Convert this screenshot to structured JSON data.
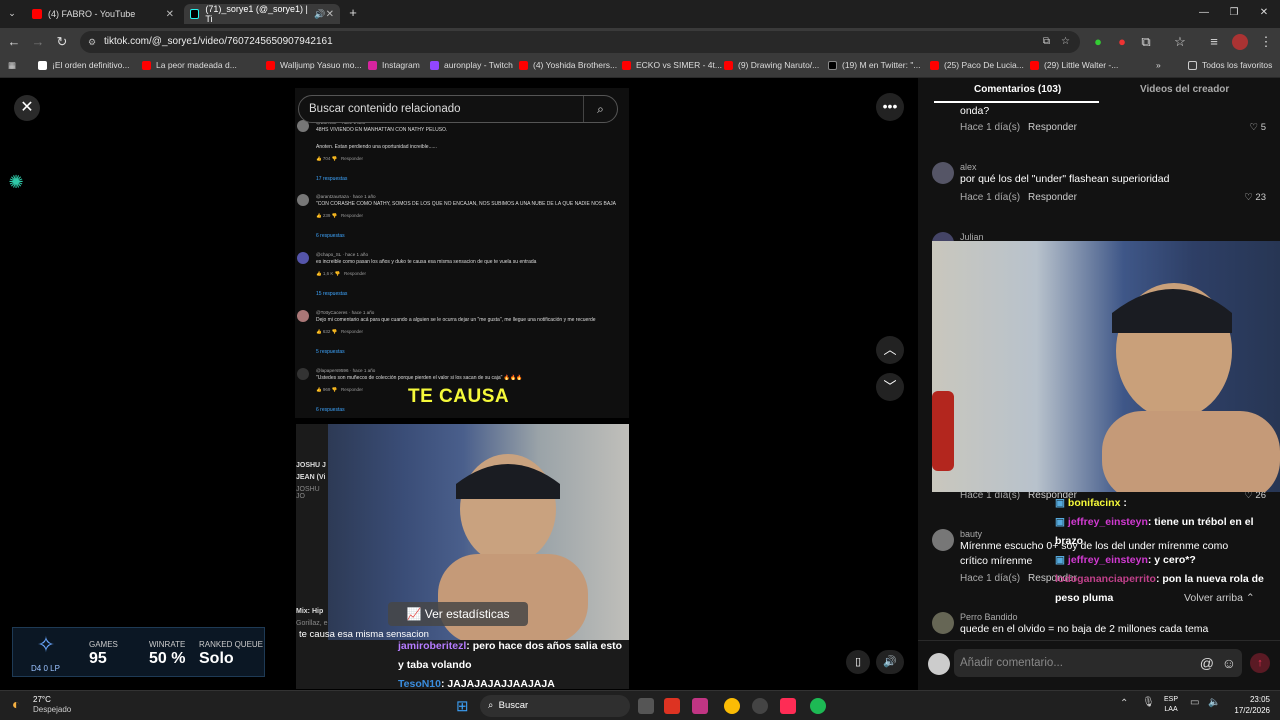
{
  "browser": {
    "tabs": [
      {
        "label": "(4) FABRO - YouTube",
        "active": false
      },
      {
        "label": "(71)_sorye1 (@_sorye1) | Ti",
        "active": true
      }
    ],
    "url": "tiktok.com/@_sorye1/video/7607245650907942161",
    "bookmarks": [
      "¡El orden definitivo...",
      "La peor madeada d...",
      "Walljump Yasuo mo...",
      "Instagram",
      "auronplay - Twitch",
      "(4) Yoshida Brothers...",
      "ECKO vs SIMER - 4t...",
      "(9) Drawing Naruto/...",
      "(19) M en Twitter: \"...",
      "(25) Paco De Lucia...",
      "(29) Little Walter -...",
      "Todos los favoritos"
    ]
  },
  "video": {
    "search_placeholder": "Buscar contenido relacionado",
    "overlay_text": "TE CAUSA",
    "stats_button": "Ver estadísticas",
    "subtitle": "te causa esa misma sensacion",
    "side_titles": [
      "JOSHU J",
      "JEAN (Vi",
      "JOSHU JO",
      "Mix: Hip",
      "Gorillaz, e"
    ],
    "embedded_comments": [
      {
        "user": "@BoRcCP",
        "time": "hace 1 año",
        "lines": [
          "48HS VIVIENDO EN MANHATTAN CON NATHY PELUSO.",
          "Anoten. Estan perdiendo una oportunidad increible......"
        ],
        "likes": "704",
        "replies": "17 respuestas"
      },
      {
        "user": "@arantzaurtaza",
        "time": "hace 1 año",
        "lines": [
          "\"CON CORASHE COMO NATHY, SOMOS DE LOS QUE NO ENCAJAN, NOS SUBIMOS A UNA NUBE DE LA QUE NADIE NOS BAJA"
        ],
        "likes": "239",
        "replies": "6 respuestas"
      },
      {
        "user": "@chapo_SL",
        "time": "hace 1 año",
        "lines": [
          "es increible como pasan los años y duko te causa esa misma sensacion de que te vuela su entrada"
        ],
        "likes": "1,6 K",
        "replies": "15 respuestas"
      },
      {
        "user": "@TottyCaceres",
        "time": "hace 1 año",
        "lines": [
          "Dejo mi comentario acá para que cuando a alguien se le ocurra dejar un \"me gusta\", me llegue una notificación y me recuerde"
        ],
        "likes": "632",
        "replies": "5 respuestas"
      },
      {
        "user": "@lapapers9596",
        "time": "hace 1 año",
        "lines": [
          "\"Ustedes son muñecos de colección porque pierden el valor si los sacan de su caja\" 🔥🔥🔥"
        ],
        "likes": "969",
        "replies": "6 respuestas"
      }
    ],
    "reply_label": "Responder",
    "chat_left": [
      {
        "user": "jamiroberitezl",
        "msg": ": pero hace dos años salia esto y taba volando",
        "color": "#b57bff"
      },
      {
        "user": "TesoN10",
        "msg": ": JAJAJAJAJJAAJAJA",
        "color": "#3a8dde"
      }
    ]
  },
  "lol": {
    "tier": "D4 0 LP",
    "games_label": "GAMES",
    "games": "95",
    "winrate_label": "WINRATE",
    "winrate": "50 %",
    "queue_label": "RANKED QUEUE",
    "queue": "Solo"
  },
  "comments_panel": {
    "tab_comments": "Comentarios (103)",
    "tab_videos": "Videos del creador",
    "reply_label": "Responder",
    "items": [
      {
        "user": "",
        "text": "onda?",
        "time": "Hace 1 día(s)",
        "likes": "5"
      },
      {
        "user": "alex",
        "text": "por qué los del \"under\" flashean superioridad",
        "time": "Hace 1 día(s)",
        "likes": "23"
      },
      {
        "user": "Julian",
        "text": "",
        "time": "Hace 1 día(s)",
        "likes": "26"
      },
      {
        "user": "bauty",
        "text": "Mírenme escucho 0+ soy de los del under mírenme como",
        "text2": "crítico mírenme",
        "time": "Hace 1 día(s)",
        "likes": ""
      },
      {
        "user": "Perro Bandido",
        "text": "quede en el olvido = no baja de 2 millones cada tema",
        "time": "",
        "likes": ""
      }
    ],
    "input_placeholder": "Añadir comentario...",
    "volver": "Volver arriba"
  },
  "chat_right": [
    {
      "user": "bonifacinx",
      "msg": " :",
      "color": "#f5f93a"
    },
    {
      "user": "jeffrey_einsteyn",
      "msg": ": tiene un trébol en el brazo",
      "color": "#d13ad1"
    },
    {
      "user": "jeffrey_einsteyn",
      "msg": ": y cero*?",
      "color": "#d13ad1"
    },
    {
      "user": "lodoganancia​perrito",
      "msg": ": pon la nueva rola de peso pluma",
      "color": "#c0408a"
    }
  ],
  "taskbar": {
    "weather_temp": "27°C",
    "weather_desc": "Despejado",
    "search": "Buscar",
    "lang1": "ESP",
    "lang2": "LAA",
    "time": "23:05",
    "date": "17/2/2026"
  },
  "colors": {
    "tiktok_accent": "#fe2c55",
    "chrome_dark": "#1f1f1f",
    "panel": "#121212"
  }
}
